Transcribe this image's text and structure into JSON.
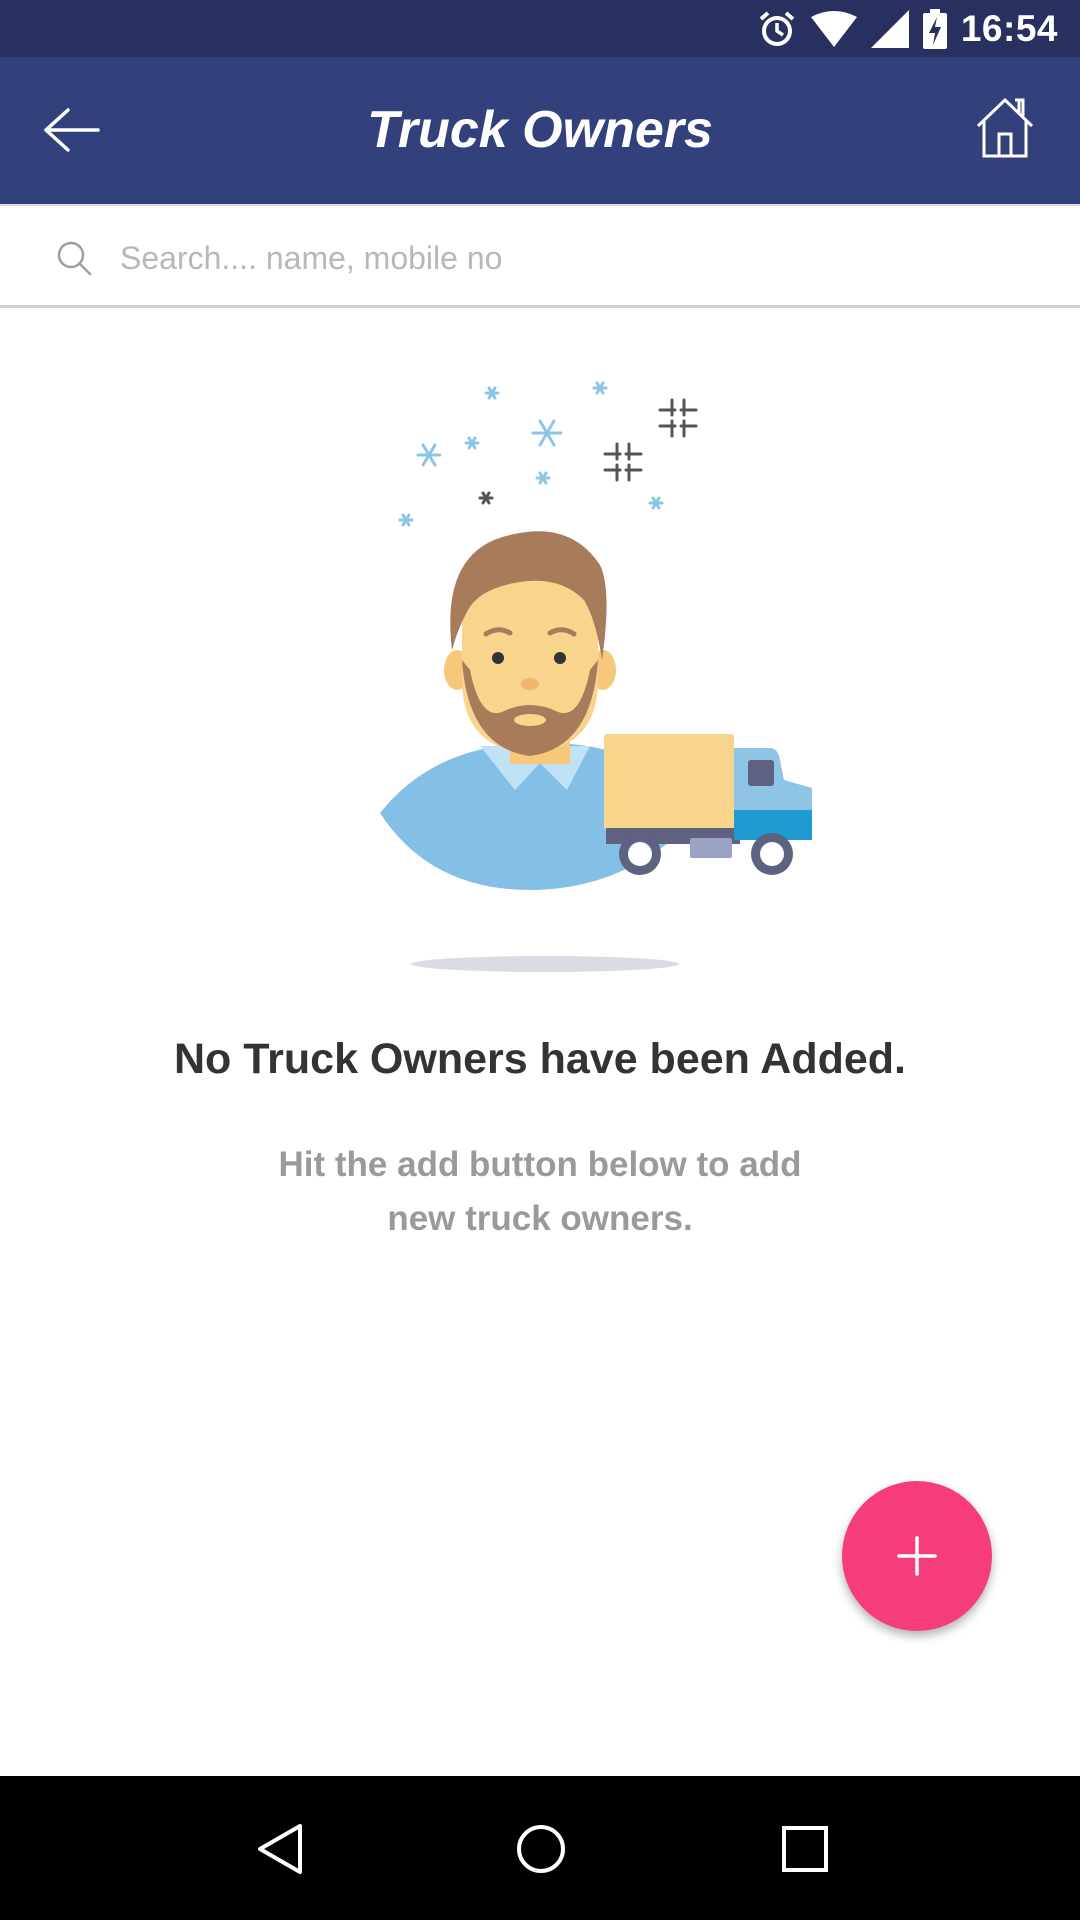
{
  "status_bar": {
    "time": "16:54",
    "icons": [
      "alarm-icon",
      "wifi-icon",
      "signal-icon",
      "battery-charging-icon"
    ]
  },
  "app_bar": {
    "title": "Truck Owners",
    "back_icon": "back-arrow-icon",
    "home_icon": "home-icon"
  },
  "search": {
    "placeholder": "Search.... name, mobile no",
    "value": ""
  },
  "empty_state": {
    "title": "No Truck Owners have been Added.",
    "subtitle_line1": "Hit the add button below to add",
    "subtitle_line2": "new truck owners."
  },
  "fab": {
    "icon": "plus-icon"
  },
  "nav_bar": {
    "icons": [
      "nav-back-icon",
      "nav-home-icon",
      "nav-recents-icon"
    ]
  },
  "colors": {
    "status_bar": "#27305e",
    "app_bar": "#32417b",
    "fab": "#f53d7e"
  }
}
